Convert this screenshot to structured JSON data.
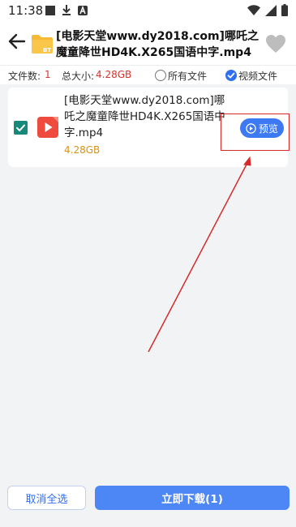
{
  "status_bar": {
    "time": "11:38",
    "icons": [
      "square-notification-icon",
      "download-icon",
      "a-logo-icon",
      "wifi-icon",
      "signal-icon",
      "battery-icon"
    ]
  },
  "header": {
    "title": "[电影天堂www.dy2018.com]哪吒之魔童降世HD4K.X265国语中字.mp4",
    "title_color": "#111111"
  },
  "info": {
    "file_count_label": "文件数:",
    "file_count": "1",
    "total_size_label": "总大小:",
    "total_size": "4.28GB",
    "filter_all_label": "所有文件",
    "filter_video_label": "视频文件",
    "selected_filter": "视频文件"
  },
  "file": {
    "name": "[电影天堂www.dy2018.com]哪吒之魔童降世HD4K.X265国语中字.mp4",
    "size": "4.28GB",
    "checked": true,
    "preview_label": "预览"
  },
  "actions": {
    "cancel_label": "取消全选",
    "download_label": "立即下载(1)"
  },
  "colors": {
    "accent": "#2f6ff2",
    "download_button": "#4d87f6",
    "checkbox": "#16897a",
    "size_text": "#d89216",
    "info_value": "#d9342b",
    "annotation": "#d62b2b"
  }
}
